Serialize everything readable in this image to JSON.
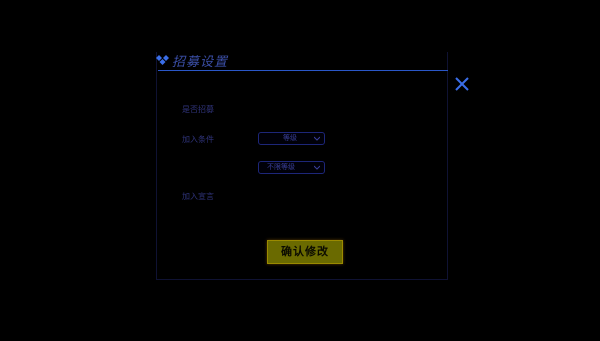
{
  "dialog": {
    "title": "招募设置",
    "rows": [
      {
        "label": "是否招募",
        "value_left": "",
        "value_right": ""
      },
      {
        "label": "加入条件",
        "prefix": "",
        "select": "等级"
      },
      {
        "prefix": "",
        "select": "不限等级"
      },
      {
        "label": "加入宣言"
      }
    ],
    "confirm_label": "确认修改"
  },
  "colors": {
    "title": "#3b4fa8",
    "title_line": "#2a57c8",
    "close": "#3a6ee8",
    "button_bg": "#6a6a00"
  },
  "icons": [
    "diamond-icon",
    "close-icon",
    "chevron-down-icon"
  ]
}
